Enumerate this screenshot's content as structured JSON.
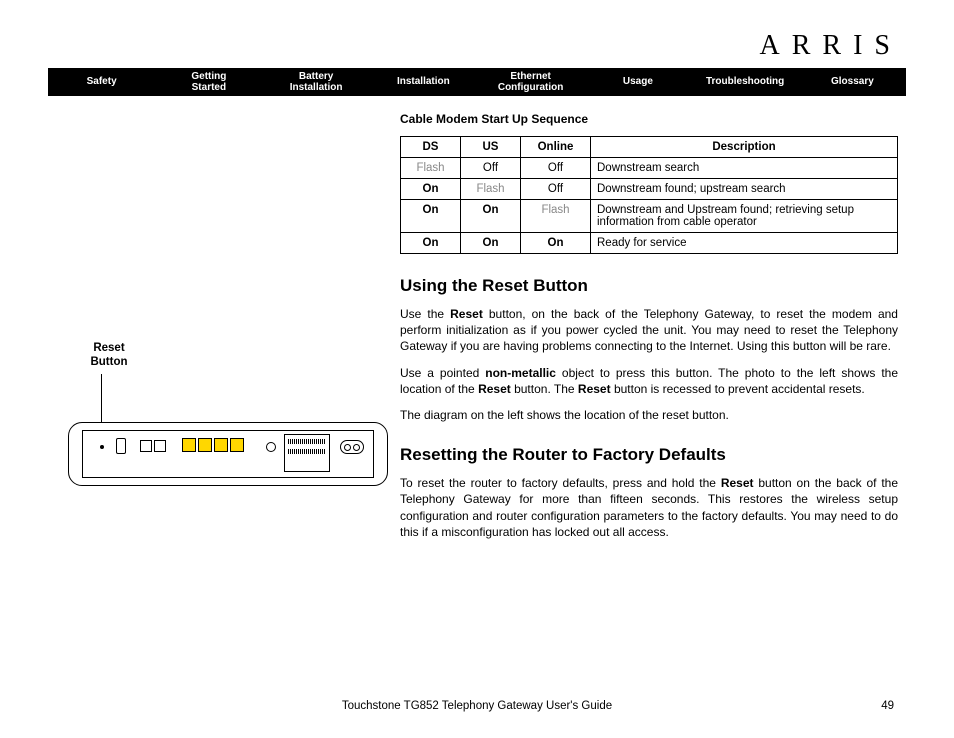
{
  "brand": "ARRIS",
  "nav": {
    "safety": "Safety",
    "getting_started": "Getting\nStarted",
    "battery_installation": "Battery\nInstallation",
    "installation": "Installation",
    "ethernet_config": "Ethernet\nConfiguration",
    "usage": "Usage",
    "troubleshooting": "Troubleshooting",
    "glossary": "Glossary"
  },
  "table_title": "Cable Modem Start Up Sequence",
  "table_headers": {
    "ds": "DS",
    "us": "US",
    "online": "Online",
    "desc": "Description"
  },
  "rows": [
    {
      "ds": "Flash",
      "us": "Off",
      "online": "Off",
      "desc": "Downstream search",
      "ds_cls": "flash",
      "us_cls": "",
      "online_cls": ""
    },
    {
      "ds": "On",
      "us": "Flash",
      "online": "Off",
      "desc": "Downstream found; upstream search",
      "ds_cls": "on",
      "us_cls": "flash",
      "online_cls": ""
    },
    {
      "ds": "On",
      "us": "On",
      "online": "Flash",
      "desc": "Downstream and Upstream found; retrieving setup information from cable operator",
      "ds_cls": "on",
      "us_cls": "on",
      "online_cls": "flash"
    },
    {
      "ds": "On",
      "us": "On",
      "online": "On",
      "desc": "Ready for service",
      "ds_cls": "on",
      "us_cls": "on",
      "online_cls": "on"
    }
  ],
  "sections": {
    "reset_heading": "Using the Reset Button",
    "reset_p1_a": "Use the ",
    "reset_p1_b": "Reset",
    "reset_p1_c": " button, on the back of the Telephony Gateway, to reset the modem and perform initialization as if you power cycled the unit. You may need to reset the Telephony Gateway if you are having problems connecting to the Internet. Using this button will be rare.",
    "reset_p2_a": "Use a pointed ",
    "reset_p2_b": "non-metallic",
    "reset_p2_c": " object to press this button. The photo to the left shows the location of the ",
    "reset_p2_d": "Reset",
    "reset_p2_e": " button. The ",
    "reset_p2_f": "Reset",
    "reset_p2_g": " button is recessed to prevent accidental resets.",
    "reset_p3": "The diagram on the left shows the location of the reset button.",
    "factory_heading": "Resetting the Router to Factory Defaults",
    "factory_p1_a": "To reset the router to factory defaults, press and hold the ",
    "factory_p1_b": "Reset",
    "factory_p1_c": " button on the back of the Telephony Gateway for more than fifteen seconds. This restores the wireless setup configuration and router configuration parameters to the factory defaults. You may need to do this if a misconfiguration has locked out all access."
  },
  "sidebar": {
    "reset_label_l1": "Reset",
    "reset_label_l2": "Button"
  },
  "footer": {
    "title": "Touchstone TG852 Telephony Gateway User's Guide",
    "page": "49"
  }
}
